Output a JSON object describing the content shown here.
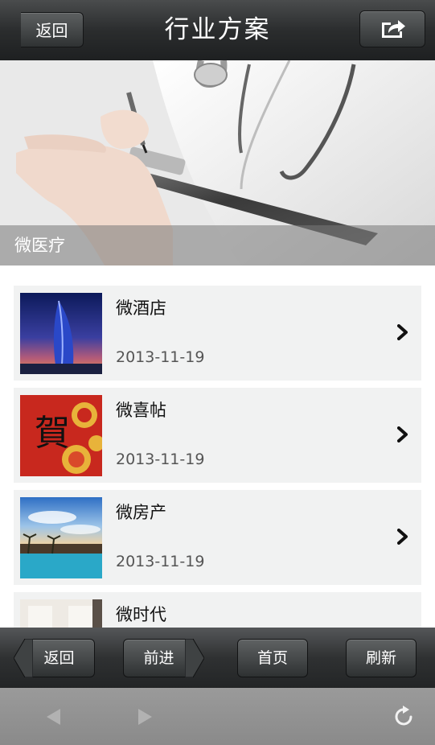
{
  "header": {
    "back_label": "返回",
    "title": "行业方案",
    "share_icon": "share-icon"
  },
  "banner": {
    "caption": "微医疗"
  },
  "list": {
    "items": [
      {
        "title": "微酒店",
        "date": "2013-11-19",
        "thumb": "hotel-tower-image"
      },
      {
        "title": "微喜帖",
        "date": "2013-11-19",
        "thumb": "red-greeting-image"
      },
      {
        "title": "微房产",
        "date": "2013-11-19",
        "thumb": "resort-pool-image"
      },
      {
        "title": "微时代",
        "date": "",
        "thumb": "white-interior-image"
      }
    ]
  },
  "bottom_nav": {
    "back": "返回",
    "forward": "前进",
    "home": "首页",
    "refresh": "刷新"
  },
  "browser": {
    "icons": [
      "back-arrow-icon",
      "forward-arrow-icon",
      "reload-icon"
    ]
  }
}
